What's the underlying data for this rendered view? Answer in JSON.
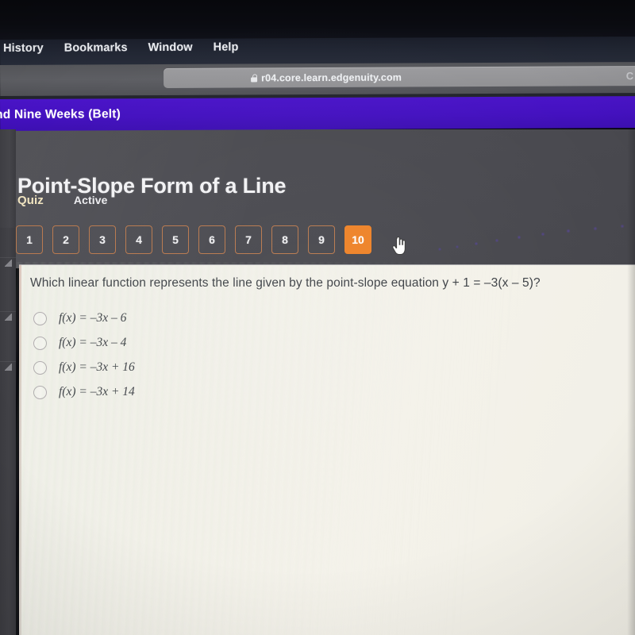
{
  "menubar": {
    "items": [
      {
        "label": "History"
      },
      {
        "label": "Bookmarks"
      },
      {
        "label": "Window"
      },
      {
        "label": "Help"
      }
    ]
  },
  "browser": {
    "lock_icon": "lock-icon",
    "url": "r04.core.learn.edgenuity.com",
    "right_glyph": "C"
  },
  "banner": {
    "text": "nd Nine Weeks (Belt)",
    "color": "#4411c0"
  },
  "header": {
    "title": "Point-Slope Form of a Line",
    "quiz_label": "Quiz",
    "status_label": "Active",
    "quiz_color": "#f0e4c0",
    "accent_color": "#ee8227"
  },
  "question_tabs": {
    "items": [
      {
        "label": "1",
        "active": false
      },
      {
        "label": "2",
        "active": false
      },
      {
        "label": "3",
        "active": false
      },
      {
        "label": "4",
        "active": false
      },
      {
        "label": "5",
        "active": false
      },
      {
        "label": "6",
        "active": false
      },
      {
        "label": "7",
        "active": false
      },
      {
        "label": "8",
        "active": false
      },
      {
        "label": "9",
        "active": false
      },
      {
        "label": "10",
        "active": true
      }
    ],
    "active_index": 10,
    "cursor_icon": "pointing-hand-cursor"
  },
  "question": {
    "text": "Which linear function represents the line given by the point-slope equation y + 1 = –3(x – 5)?",
    "options": [
      {
        "text": "f(x) = –3x – 6",
        "selected": false
      },
      {
        "text": "f(x) = –3x – 4",
        "selected": false
      },
      {
        "text": "f(x) = –3x + 16",
        "selected": false
      },
      {
        "text": "f(x) = –3x + 14",
        "selected": false
      }
    ]
  },
  "sidebar": {
    "grip_icon": "resize-grip-icon",
    "grip_count": 3
  }
}
